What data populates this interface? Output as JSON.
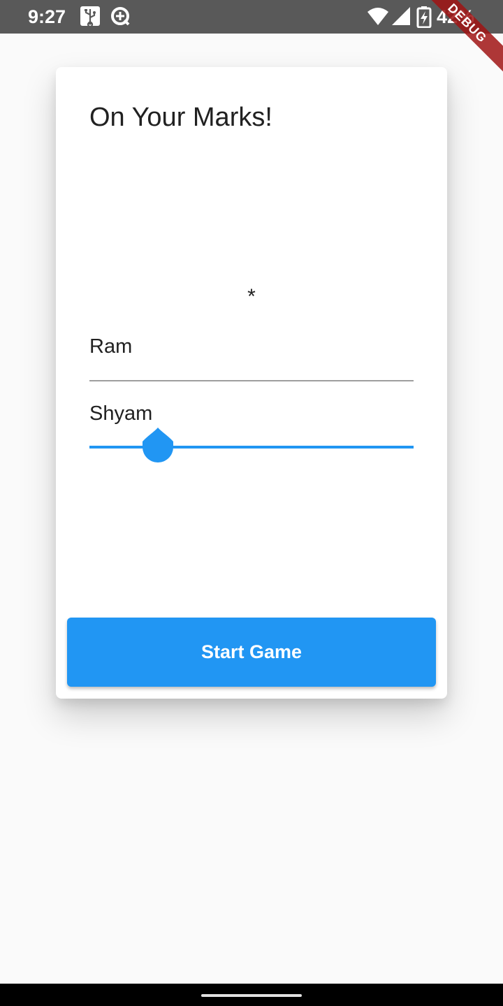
{
  "status_bar": {
    "time": "9:27",
    "battery_percent": "42%",
    "icons": [
      "usb-icon",
      "data-saver-icon",
      "wifi-icon",
      "signal-icon",
      "battery-charging-icon"
    ]
  },
  "debug_banner": "DEBUG",
  "card": {
    "title": "On Your Marks!",
    "asterisk": "*",
    "player1_name": "Ram",
    "player2_name": "Shyam",
    "slider_value_fraction": 0.21,
    "start_button_label": "Start Game"
  },
  "colors": {
    "accent": "#2196f3",
    "status_bar": "#595959",
    "background": "#fafafa",
    "debug_ribbon": "#a01414"
  }
}
